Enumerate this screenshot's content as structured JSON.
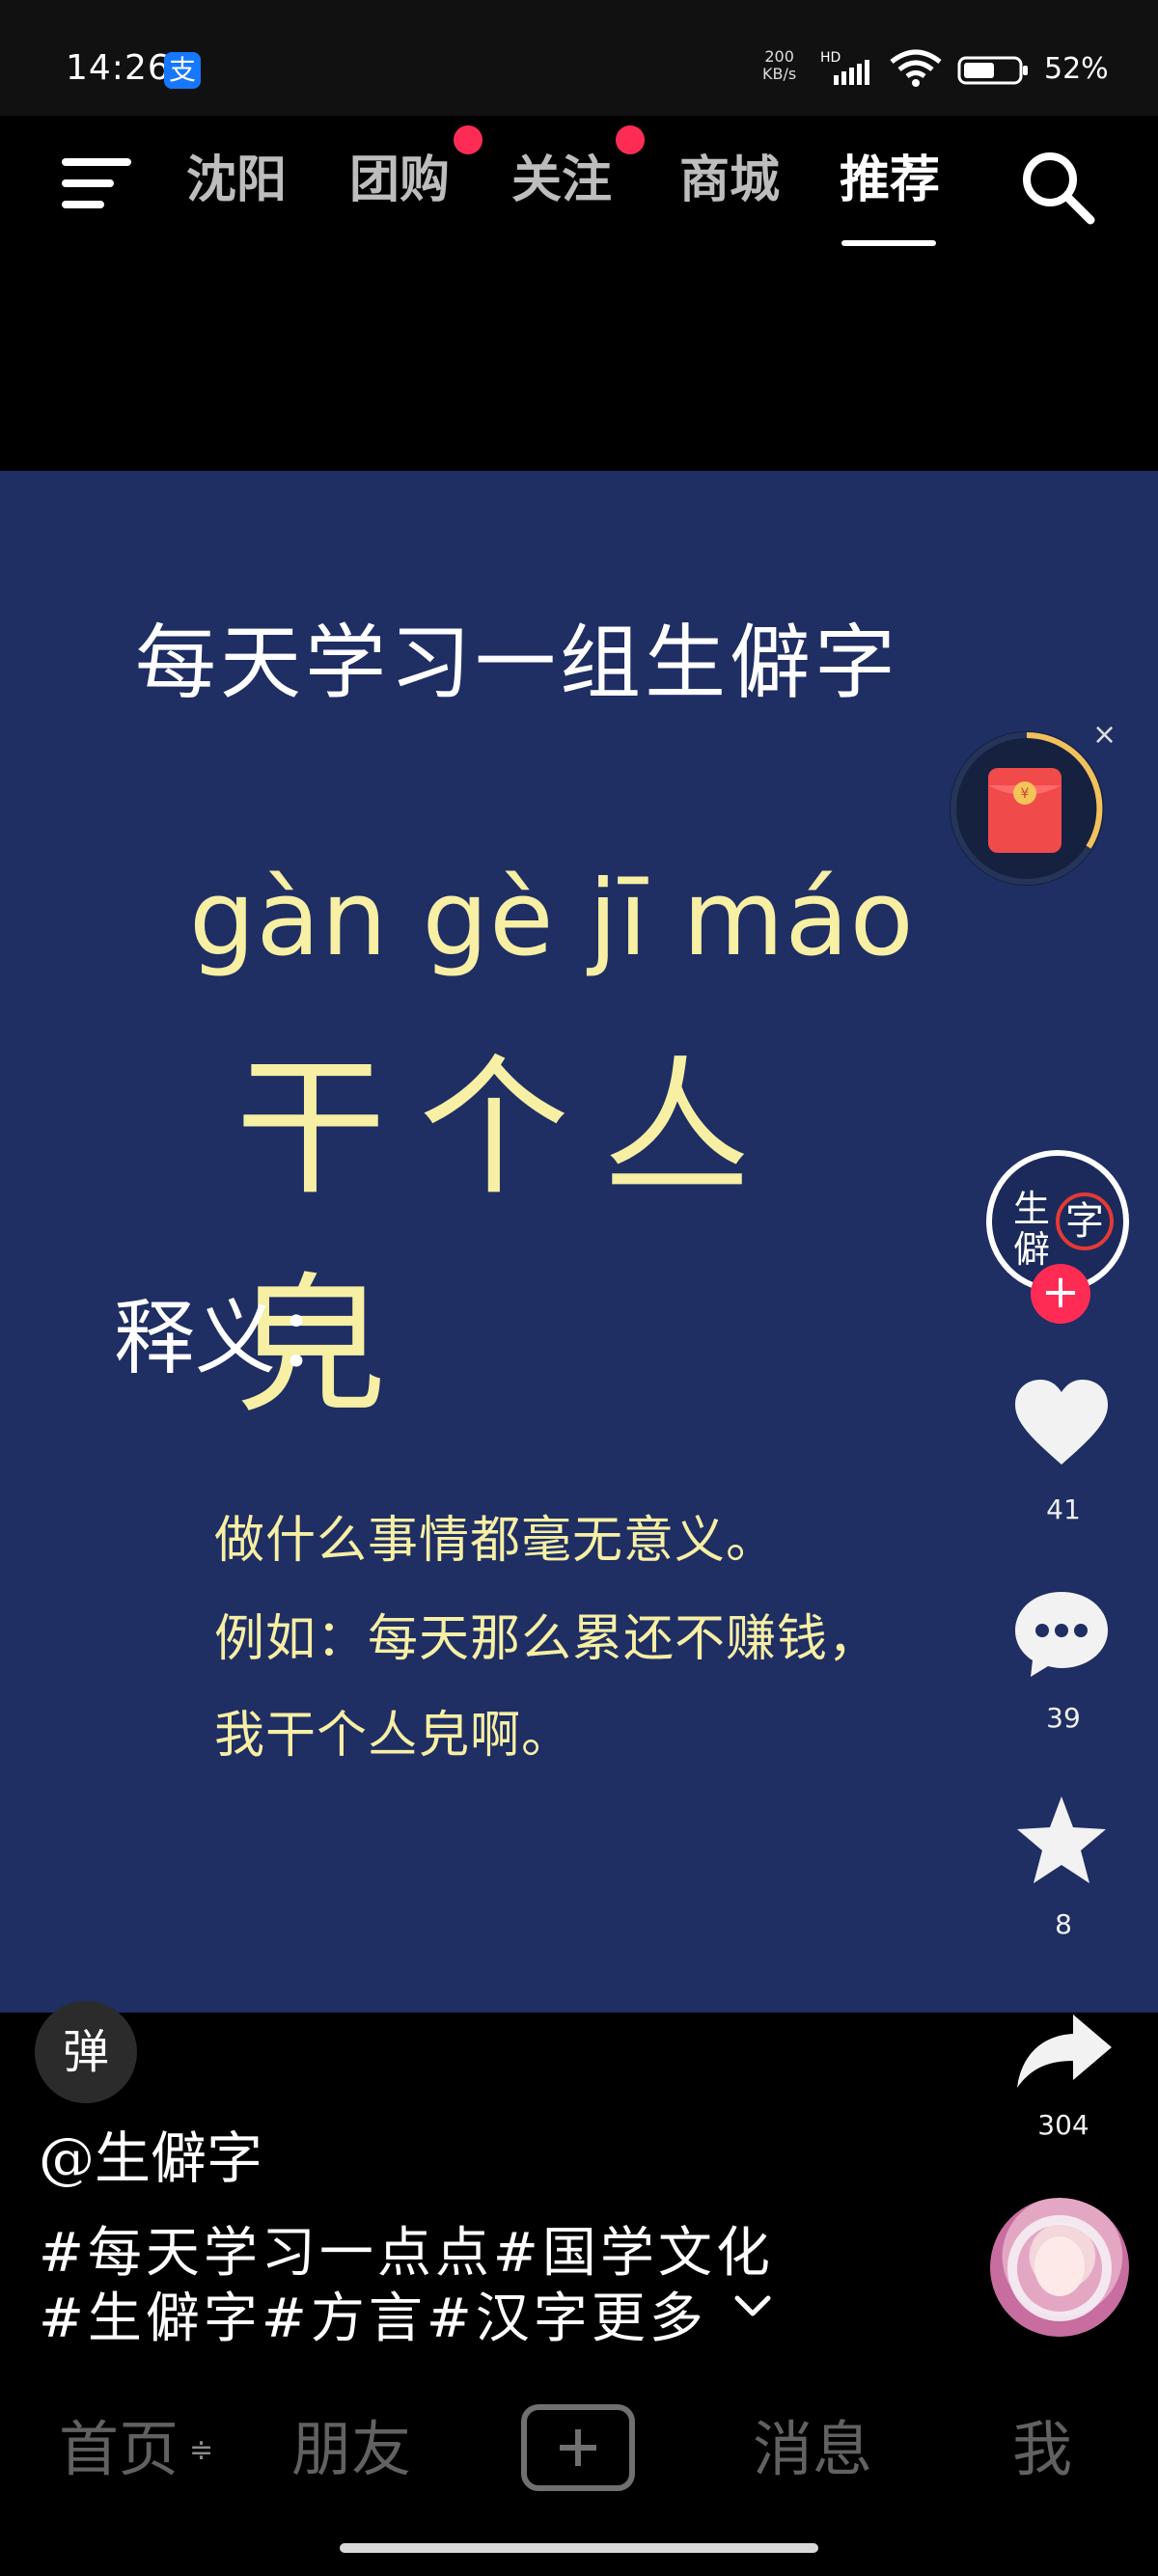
{
  "status_bar": {
    "time": "14:26",
    "alipay_icon": "支",
    "network_speed_top": "200",
    "network_speed_bottom": "KB/s",
    "network_type": "HD",
    "battery": "52%",
    "icons": [
      "alipay-icon",
      "signal-icon",
      "wifi-icon",
      "battery-icon"
    ]
  },
  "top_nav": {
    "tabs": [
      {
        "label": "沈阳",
        "active": false,
        "badge": false
      },
      {
        "label": "团购",
        "active": false,
        "badge": true
      },
      {
        "label": "关注",
        "active": false,
        "badge": true
      },
      {
        "label": "商城",
        "active": false,
        "badge": false
      },
      {
        "label": "推荐",
        "active": true,
        "badge": false
      }
    ],
    "icons": [
      "menu-icon",
      "search-icon"
    ],
    "accent_color": "#fe2c55"
  },
  "video": {
    "headline": "每天学习一组生僻字",
    "pinyin": "gàn gè jī máo",
    "characters": "干个亼皃",
    "definition_label": "释义：",
    "definition_lines": [
      "做什么事情都毫无意义。",
      "例如：每天那么累还不赚钱，",
      "我干个亼皃啊。"
    ],
    "background_color": "#1f2e63",
    "highlight_color": "#f6efa4"
  },
  "red_packet": {
    "close_label": "×",
    "icon": "red-packet-icon"
  },
  "rail": {
    "creator_avatar_lines": [
      "生",
      "僻",
      "字"
    ],
    "follow_label": "+",
    "likes": "41",
    "comments": "39",
    "favorites": "8",
    "shares": "304",
    "icons": [
      "heart-icon",
      "comment-icon",
      "star-icon",
      "share-icon"
    ]
  },
  "caption": {
    "danmaku_label": "弹",
    "creator_handle": "@生僻字",
    "tags_line_1": "#每天学习一点点#国学文化",
    "tags_line_2": "#生僻字#方言#汉字更多",
    "more_icon": "chevron-down-icon"
  },
  "bottom_nav": {
    "tabs": [
      {
        "label": "首页"
      },
      {
        "label": "朋友"
      },
      {
        "label": "消息"
      },
      {
        "label": "我"
      }
    ],
    "refresh_mark": "≑",
    "create_icon": "plus-square-icon"
  }
}
